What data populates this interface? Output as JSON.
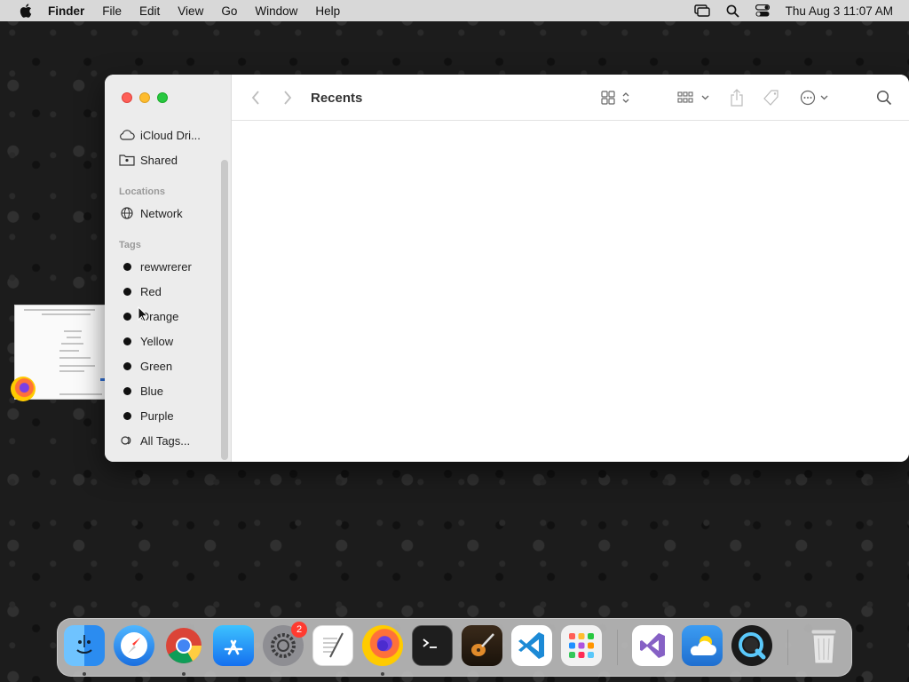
{
  "menubar": {
    "apple": "apple-icon",
    "items": [
      "Finder",
      "File",
      "Edit",
      "View",
      "Go",
      "Window",
      "Help"
    ],
    "datetime": "Thu Aug 3  11:07 AM"
  },
  "window": {
    "title": "Recents",
    "sidebar": {
      "items_top": [
        {
          "label": "iCloud Dri...",
          "icon": "cloud-icon"
        },
        {
          "label": "Shared",
          "icon": "shared-folder-icon"
        }
      ],
      "locations_header": "Locations",
      "locations": [
        {
          "label": "Network",
          "icon": "globe-icon"
        }
      ],
      "tags_header": "Tags",
      "tags": [
        {
          "label": "rewwrerer"
        },
        {
          "label": "Red"
        },
        {
          "label": "Orange"
        },
        {
          "label": "Yellow"
        },
        {
          "label": "Green"
        },
        {
          "label": "Blue"
        },
        {
          "label": "Purple"
        }
      ],
      "all_tags": "All Tags..."
    }
  },
  "dock": {
    "apps": [
      {
        "name": "Finder",
        "running": true
      },
      {
        "name": "Safari",
        "running": false
      },
      {
        "name": "Chrome",
        "running": true
      },
      {
        "name": "App Store",
        "running": false
      },
      {
        "name": "System Settings",
        "running": false,
        "badge": "2"
      },
      {
        "name": "TextEdit",
        "running": false
      },
      {
        "name": "Firefox",
        "running": true
      },
      {
        "name": "Terminal",
        "running": false
      },
      {
        "name": "GarageBand",
        "running": false
      },
      {
        "name": "Visual Studio Code",
        "running": false
      },
      {
        "name": "Launchpad",
        "running": false
      },
      {
        "name": "Visual Studio",
        "running": false
      },
      {
        "name": "Weather",
        "running": false
      },
      {
        "name": "QuickTime",
        "running": false
      },
      {
        "name": "Trash",
        "running": false
      }
    ]
  }
}
